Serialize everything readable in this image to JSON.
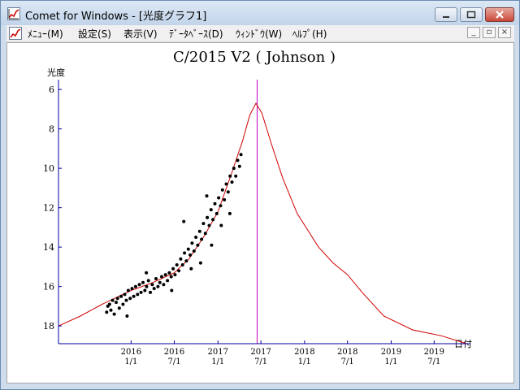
{
  "window": {
    "title": "Comet for Windows - [光度グラフ1]"
  },
  "menu": {
    "items": [
      "ﾒﾆｭｰ(M)",
      "設定(S)",
      "表示(V)",
      "ﾃﾞｰﾀﾍﾞｰｽ(D)",
      "ｳｨﾝﾄﾞｳ(W)",
      "ﾍﾙﾌﾟ(H)"
    ]
  },
  "icons": {
    "app": "comet-graph-icon",
    "minimize": "minimize-icon",
    "maximize": "maximize-icon",
    "close": "close-icon"
  },
  "colors": {
    "curve": "#d00000",
    "marker": "#c000c0",
    "axis": "#0000a0",
    "points": "#000000"
  },
  "chart_data": {
    "type": "scatter",
    "title": "C/2015 V2 ( Johnson )",
    "ylabel": "光度",
    "xlabel": "日付",
    "y_inverted": true,
    "ylim": [
      5.5,
      18.9
    ],
    "yticks": [
      6,
      8,
      10,
      12,
      14,
      16,
      18
    ],
    "xlim": [
      "2015-03-01",
      "2019-12-01"
    ],
    "xticks": [
      {
        "date": "2016-01-01",
        "year": "2016",
        "md": "1/1"
      },
      {
        "date": "2016-07-01",
        "year": "2016",
        "md": "7/1"
      },
      {
        "date": "2017-01-01",
        "year": "2017",
        "md": "1/1"
      },
      {
        "date": "2017-07-01",
        "year": "2017",
        "md": "7/1"
      },
      {
        "date": "2018-01-01",
        "year": "2018",
        "md": "1/1"
      },
      {
        "date": "2018-07-01",
        "year": "2018",
        "md": "7/1"
      },
      {
        "date": "2019-01-01",
        "year": "2019",
        "md": "1/1"
      },
      {
        "date": "2019-07-01",
        "year": "2019",
        "md": "7/1"
      }
    ],
    "marker_date": "2017-06-15",
    "predicted_curve": [
      {
        "date": "2015-03-01",
        "mag": 18.0
      },
      {
        "date": "2015-06-01",
        "mag": 17.5
      },
      {
        "date": "2015-09-01",
        "mag": 16.9
      },
      {
        "date": "2016-01-01",
        "mag": 16.2
      },
      {
        "date": "2016-04-01",
        "mag": 15.8
      },
      {
        "date": "2016-07-01",
        "mag": 15.3
      },
      {
        "date": "2016-09-01",
        "mag": 14.6
      },
      {
        "date": "2016-11-01",
        "mag": 13.5
      },
      {
        "date": "2017-01-01",
        "mag": 12.2
      },
      {
        "date": "2017-03-01",
        "mag": 10.2
      },
      {
        "date": "2017-04-15",
        "mag": 8.6
      },
      {
        "date": "2017-05-15",
        "mag": 7.3
      },
      {
        "date": "2017-06-10",
        "mag": 6.7
      },
      {
        "date": "2017-07-05",
        "mag": 7.2
      },
      {
        "date": "2017-08-15",
        "mag": 8.8
      },
      {
        "date": "2017-10-01",
        "mag": 10.5
      },
      {
        "date": "2017-12-01",
        "mag": 12.3
      },
      {
        "date": "2018-03-01",
        "mag": 14.0
      },
      {
        "date": "2018-05-01",
        "mag": 14.8
      },
      {
        "date": "2018-07-01",
        "mag": 15.4
      },
      {
        "date": "2018-09-01",
        "mag": 16.3
      },
      {
        "date": "2018-12-01",
        "mag": 17.5
      },
      {
        "date": "2019-04-01",
        "mag": 18.2
      },
      {
        "date": "2019-08-01",
        "mag": 18.5
      },
      {
        "date": "2019-11-15",
        "mag": 18.9
      }
    ],
    "observations": [
      [
        "2015-09-20",
        17.3
      ],
      [
        "2015-09-25",
        17.0
      ],
      [
        "2015-10-02",
        16.9
      ],
      [
        "2015-10-08",
        17.2
      ],
      [
        "2015-10-15",
        16.7
      ],
      [
        "2015-10-22",
        17.4
      ],
      [
        "2015-10-30",
        16.8
      ],
      [
        "2015-11-05",
        16.6
      ],
      [
        "2015-11-12",
        17.1
      ],
      [
        "2015-11-20",
        16.5
      ],
      [
        "2015-11-28",
        16.9
      ],
      [
        "2015-12-05",
        16.4
      ],
      [
        "2015-12-12",
        16.7
      ],
      [
        "2015-12-20",
        16.2
      ],
      [
        "2015-12-28",
        16.6
      ],
      [
        "2016-01-05",
        16.1
      ],
      [
        "2016-01-12",
        16.5
      ],
      [
        "2016-01-20",
        16.0
      ],
      [
        "2016-01-28",
        16.4
      ],
      [
        "2016-02-05",
        15.9
      ],
      [
        "2016-02-12",
        16.3
      ],
      [
        "2016-02-20",
        15.8
      ],
      [
        "2016-02-28",
        16.2
      ],
      [
        "2016-03-06",
        16.0
      ],
      [
        "2016-03-14",
        15.7
      ],
      [
        "2016-03-22",
        16.3
      ],
      [
        "2016-03-30",
        15.9
      ],
      [
        "2016-04-07",
        16.1
      ],
      [
        "2016-04-15",
        15.6
      ],
      [
        "2016-04-23",
        16.0
      ],
      [
        "2016-05-01",
        15.8
      ],
      [
        "2016-05-09",
        15.5
      ],
      [
        "2016-05-17",
        15.9
      ],
      [
        "2016-05-25",
        15.4
      ],
      [
        "2016-06-02",
        15.7
      ],
      [
        "2016-06-10",
        15.3
      ],
      [
        "2016-06-18",
        15.5
      ],
      [
        "2016-06-26",
        15.1
      ],
      [
        "2016-07-04",
        15.4
      ],
      [
        "2016-07-12",
        14.9
      ],
      [
        "2016-07-20",
        15.2
      ],
      [
        "2016-07-28",
        14.6
      ],
      [
        "2016-08-05",
        14.9
      ],
      [
        "2016-08-13",
        14.3
      ],
      [
        "2016-08-21",
        14.7
      ],
      [
        "2016-08-29",
        14.1
      ],
      [
        "2016-09-06",
        14.4
      ],
      [
        "2016-09-14",
        13.8
      ],
      [
        "2016-09-22",
        14.2
      ],
      [
        "2016-09-30",
        13.5
      ],
      [
        "2016-10-08",
        13.9
      ],
      [
        "2016-10-16",
        13.2
      ],
      [
        "2016-10-24",
        13.6
      ],
      [
        "2016-11-01",
        12.8
      ],
      [
        "2016-11-09",
        13.3
      ],
      [
        "2016-11-17",
        12.5
      ],
      [
        "2016-11-25",
        12.9
      ],
      [
        "2016-12-03",
        12.1
      ],
      [
        "2016-12-11",
        12.6
      ],
      [
        "2016-12-19",
        11.8
      ],
      [
        "2016-12-27",
        12.3
      ],
      [
        "2017-01-04",
        11.5
      ],
      [
        "2017-01-12",
        11.9
      ],
      [
        "2017-01-20",
        11.1
      ],
      [
        "2017-01-28",
        11.6
      ],
      [
        "2017-02-05",
        10.8
      ],
      [
        "2017-02-13",
        11.2
      ],
      [
        "2017-02-21",
        10.4
      ],
      [
        "2017-03-01",
        10.7
      ],
      [
        "2017-03-09",
        10.0
      ],
      [
        "2017-03-17",
        10.4
      ],
      [
        "2017-03-25",
        9.6
      ],
      [
        "2017-04-02",
        9.9
      ],
      [
        "2017-04-08",
        9.3
      ],
      [
        "2016-09-10",
        15.1
      ],
      [
        "2016-10-20",
        14.8
      ],
      [
        "2016-12-05",
        13.9
      ],
      [
        "2017-01-15",
        12.9
      ],
      [
        "2017-02-20",
        12.3
      ],
      [
        "2016-06-20",
        16.2
      ],
      [
        "2016-08-10",
        12.7
      ],
      [
        "2016-11-15",
        11.4
      ],
      [
        "2016-03-05",
        15.3
      ],
      [
        "2015-12-15",
        17.5
      ]
    ]
  }
}
